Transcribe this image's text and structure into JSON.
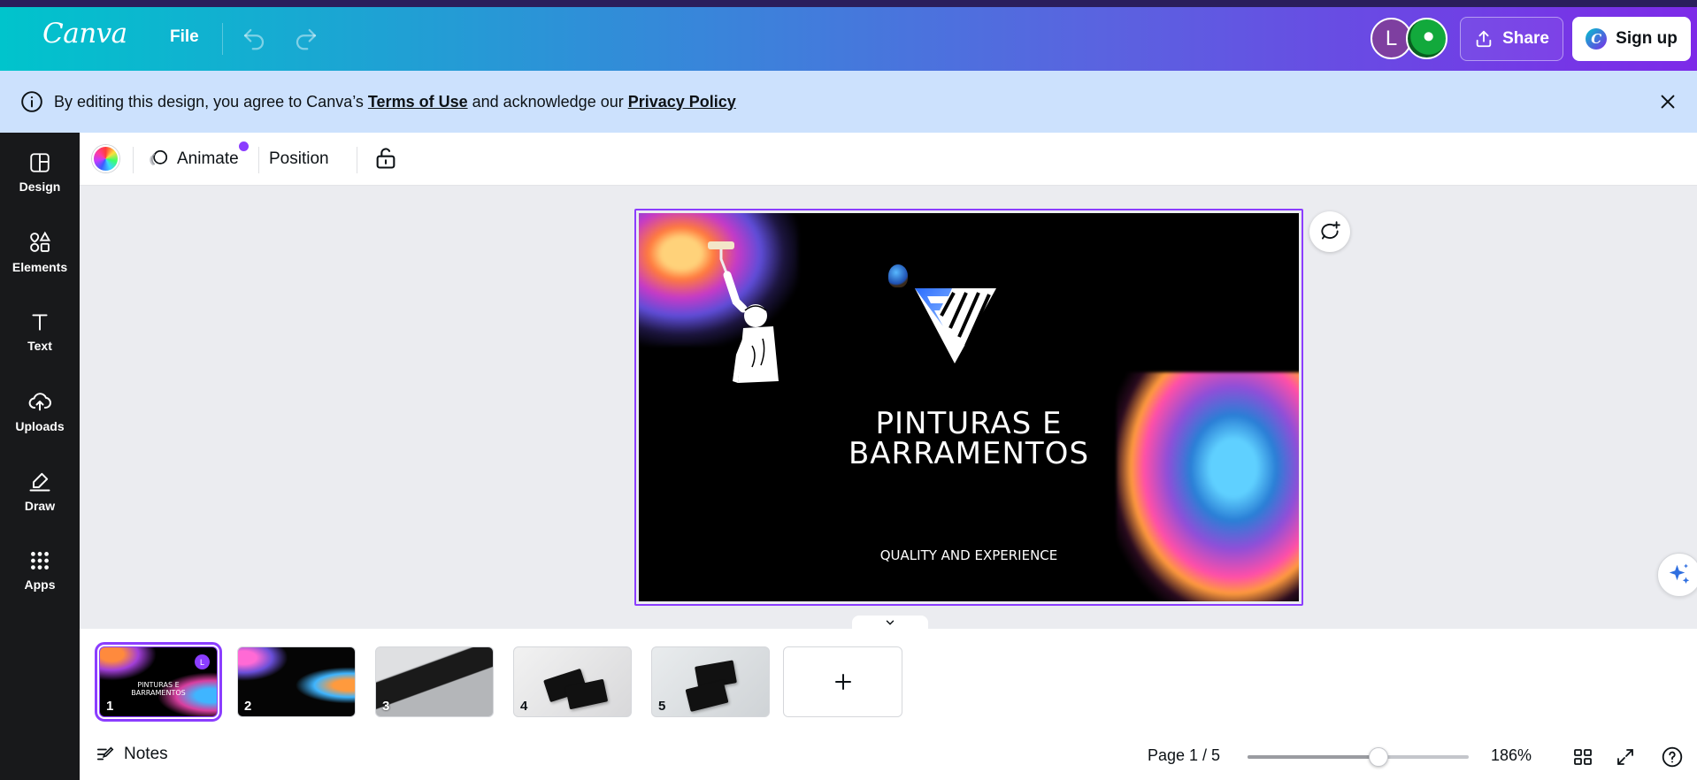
{
  "header": {
    "logo": "Canva",
    "file_label": "File",
    "avatar_initial": "L",
    "share_label": "Share",
    "signup_label": "Sign up",
    "gradient_colors": [
      "#00c4cc",
      "#7d2ae8"
    ]
  },
  "notice": {
    "text_before": "By editing this design, you agree to Canva’s ",
    "terms_link": "Terms of Use",
    "text_middle": " and acknowledge our ",
    "privacy_link": "Privacy Policy",
    "background": "#cce1fd"
  },
  "sidebar": {
    "items": [
      {
        "label": "Design",
        "icon": "design-icon"
      },
      {
        "label": "Elements",
        "icon": "elements-icon"
      },
      {
        "label": "Text",
        "icon": "text-icon"
      },
      {
        "label": "Uploads",
        "icon": "uploads-icon"
      },
      {
        "label": "Draw",
        "icon": "draw-icon"
      },
      {
        "label": "Apps",
        "icon": "apps-icon"
      }
    ]
  },
  "toolbar": {
    "animate_label": "Animate",
    "position_label": "Position"
  },
  "design": {
    "title_line1": "PINTURAS E",
    "title_line2": "BARRAMENTOS",
    "tagline": "QUALITY AND EXPERIENCE",
    "accent_color": "#8b3dff"
  },
  "pages": {
    "thumbnails": [
      {
        "number": "1",
        "selected": true,
        "mini_title_1": "PINTURAS E",
        "mini_title_2": "BARRAMENTOS",
        "avatar": "L"
      },
      {
        "number": "2",
        "selected": false
      },
      {
        "number": "3",
        "selected": false
      },
      {
        "number": "4",
        "selected": false
      },
      {
        "number": "5",
        "selected": false
      }
    ]
  },
  "footer": {
    "notes_label": "Notes",
    "page_indicator": "Page 1 / 5",
    "zoom_level": "186%",
    "zoom_slider_fraction": 0.59
  }
}
